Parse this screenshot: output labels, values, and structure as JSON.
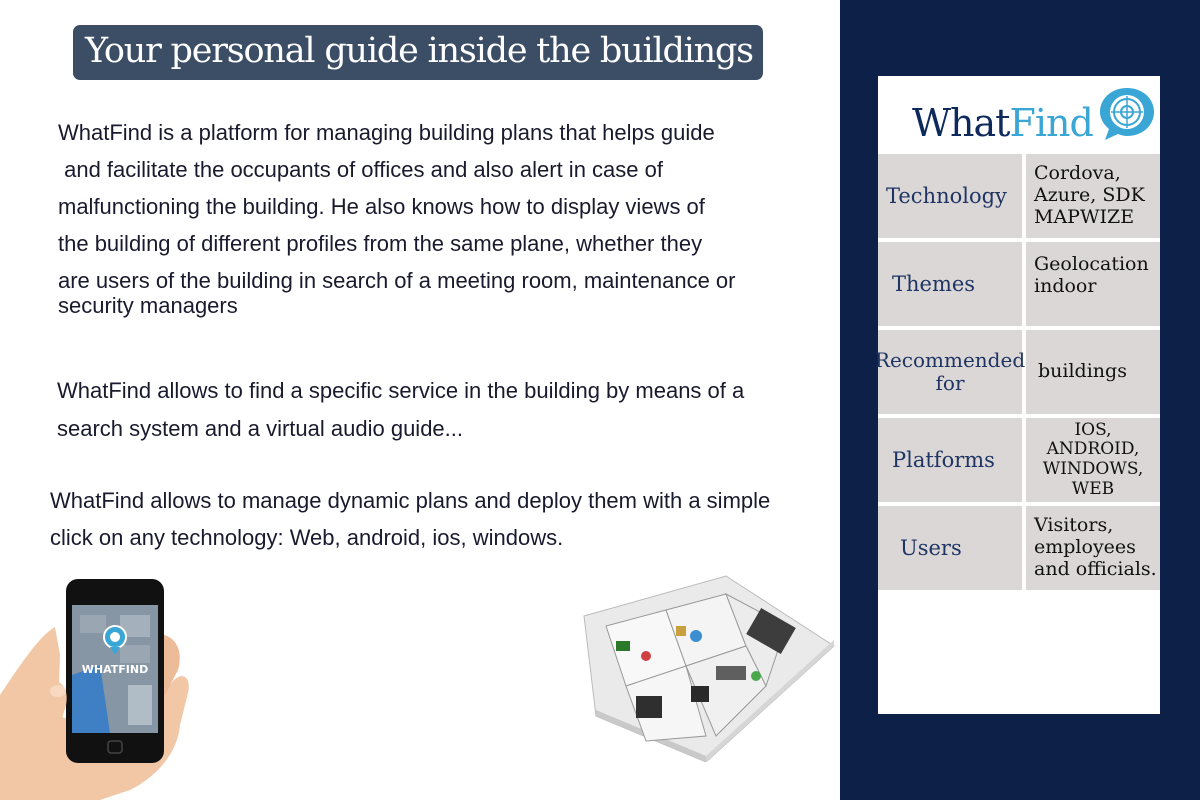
{
  "headline": "Your personal guide inside the buildings",
  "paragraphs": {
    "p1": [
      "WhatFind is a platform for managing building plans that helps guide",
      " and facilitate the occupants of offices and also alert in case of",
      "malfunctioning the building. He also knows how to display views of",
      "the building of different profiles from the same plane, whether they",
      "are users of the building in search of a meeting room, maintenance or",
      "security managers"
    ],
    "p2": [
      "WhatFind allows to find a specific service in the building by means of a",
      "search system and a virtual audio guide..."
    ],
    "p3": [
      "WhatFind allows to manage dynamic plans and deploy them with a simple",
      "click on any technology: Web, android, ios, windows."
    ]
  },
  "phone": {
    "screen_label": "WHATFIND"
  },
  "card": {
    "logo_what": "What",
    "logo_find": "Find",
    "rows": [
      {
        "label": "Technology",
        "value": "Cordova, Azure, SDK MAPWIZE"
      },
      {
        "label": "Themes",
        "value": "Geolocation indoor"
      },
      {
        "label": "Recommended for",
        "value": "buildings"
      },
      {
        "label": "Platforms",
        "value": "IOS, ANDROID, WINDOWS, WEB"
      },
      {
        "label": "Users",
        "value": "Visitors, employees and officials."
      }
    ]
  },
  "colors": {
    "navy_panel": "#0d2148",
    "headline_bg": "#3c4d66",
    "table_cell": "#dcd7d7",
    "logo_blue": "#3aa6d6",
    "logo_navy": "#0e2a5c"
  }
}
